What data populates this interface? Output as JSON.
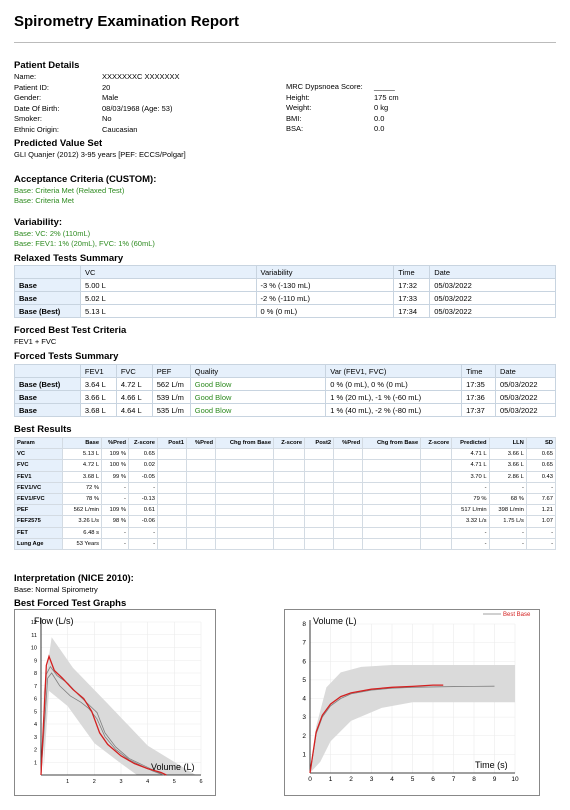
{
  "report": {
    "title": "Spirometry Examination Report"
  },
  "patient": {
    "heading": "Patient Details",
    "name_label": "Name:",
    "name_value": "XXXXXXXC XXXXXXX",
    "id_label": "Patient ID:",
    "id_value": "20",
    "gender_label": "Gender:",
    "gender_value": "Male",
    "dob_label": "Date Of Birth:",
    "dob_value": "08/03/1968   (Age: 53)",
    "smoker_label": "Smoker:",
    "smoker_value": "No",
    "ethnic_label": "Ethnic Origin:",
    "ethnic_value": "Caucasian",
    "mrc_label": "MRC Dypsnoea Score:",
    "mrc_value": "_____",
    "height_label": "Height:",
    "height_value": "175 cm",
    "weight_label": "Weight:",
    "weight_value": "0 kg",
    "bmi_label": "BMI:",
    "bmi_value": "0.0",
    "bsa_label": "BSA:",
    "bsa_value": "0.0"
  },
  "predicted": {
    "heading": "Predicted Value Set",
    "text": "GLI Quanjer (2012) 3-95 years [PEF: ECCS/Polgar]"
  },
  "acceptance": {
    "heading": "Acceptance Criteria (CUSTOM):",
    "line1": "Base: Criteria Met (Relaxed Test)",
    "line2": "Base: Criteria Met"
  },
  "variability": {
    "heading": "Variability:",
    "line1": "Base:  VC: 2% (110mL)",
    "line2": "Base:  FEV1: 1% (20mL), FVC: 1% (60mL)"
  },
  "relaxed": {
    "heading": "Relaxed Tests Summary",
    "headers": [
      "",
      "VC",
      "Variability",
      "Time",
      "Date"
    ],
    "rows": [
      [
        "Base",
        "5.00 L",
        "-3 % (-130 mL)",
        "17:32",
        "05/03/2022"
      ],
      [
        "Base",
        "5.02 L",
        "-2 % (-110 mL)",
        "17:33",
        "05/03/2022"
      ],
      [
        "Base (Best)",
        "5.13 L",
        "0 % (0 mL)",
        "17:34",
        "05/03/2022"
      ]
    ]
  },
  "forced_criteria": {
    "heading": "Forced Best Test Criteria",
    "text": "FEV1 + FVC"
  },
  "forced": {
    "heading": "Forced Tests Summary",
    "headers": [
      "",
      "FEV1",
      "FVC",
      "PEF",
      "Quality",
      "Var (FEV1, FVC)",
      "Time",
      "Date"
    ],
    "rows": [
      [
        "Base (Best)",
        "3.64 L",
        "4.72 L",
        "562 L/m",
        "Good Blow",
        "0 % (0 mL), 0 % (0 mL)",
        "17:35",
        "05/03/2022"
      ],
      [
        "Base",
        "3.66 L",
        "4.66 L",
        "539 L/m",
        "Good Blow",
        "1 % (20 mL), -1 % (-60 mL)",
        "17:36",
        "05/03/2022"
      ],
      [
        "Base",
        "3.68 L",
        "4.64 L",
        "535 L/m",
        "Good Blow",
        "1 % (40 mL), -2 % (-80 mL)",
        "17:37",
        "05/03/2022"
      ]
    ]
  },
  "best": {
    "heading": "Best Results",
    "headers": [
      "Param",
      "Base",
      "%Pred",
      "Z-score",
      "Post1",
      "%Pred",
      "Chg from Base",
      "Z-score",
      "Post2",
      "%Pred",
      "Chg from Base",
      "Z-score",
      "Predicted",
      "LLN",
      "SD"
    ],
    "rows": [
      [
        "VC",
        "5.13 L",
        "109 %",
        "0.65",
        "",
        "",
        "",
        "",
        "",
        "",
        "",
        "",
        "4.71 L",
        "3.66 L",
        "0.65"
      ],
      [
        "FVC",
        "4.72 L",
        "100 %",
        "0.02",
        "",
        "",
        "",
        "",
        "",
        "",
        "",
        "",
        "4.71 L",
        "3.66 L",
        "0.65"
      ],
      [
        "FEV1",
        "3.68 L",
        "99 %",
        "-0.05",
        "",
        "",
        "",
        "",
        "",
        "",
        "",
        "",
        "3.70 L",
        "2.86 L",
        "0.43"
      ],
      [
        "FEV1/VC",
        "72 %",
        "-",
        "-",
        "",
        "",
        "",
        "",
        "",
        "",
        "",
        "",
        "-",
        "-",
        "-"
      ],
      [
        "FEV1/FVC",
        "78 %",
        "-",
        "-0.13",
        "",
        "",
        "",
        "",
        "",
        "",
        "",
        "",
        "79 %",
        "68 %",
        "7.67"
      ],
      [
        "PEF",
        "562 L/min",
        "109 %",
        "0.61",
        "",
        "",
        "",
        "",
        "",
        "",
        "",
        "",
        "517 L/min",
        "398 L/min",
        "1.21"
      ],
      [
        "FEF2575",
        "3.26 L/s",
        "98 %",
        "-0.06",
        "",
        "",
        "",
        "",
        "",
        "",
        "",
        "",
        "3.32 L/s",
        "1.75 L/s",
        "1.07"
      ],
      [
        "FET",
        "6.48 s",
        "-",
        "-",
        "",
        "",
        "",
        "",
        "",
        "",
        "",
        "",
        "-",
        "-",
        "-"
      ],
      [
        "Lung Age",
        "53 Years",
        "-",
        "-",
        "",
        "",
        "",
        "",
        "",
        "",
        "",
        "",
        "-",
        "-",
        "-"
      ]
    ]
  },
  "interpretation": {
    "heading": "Interpretation (NICE 2010):",
    "text": "Base: Normal Spirometry"
  },
  "graphs": {
    "heading": "Best Forced Test Graphs",
    "flow_ylabel": "Flow (L/s)",
    "flow_xlabel": "Volume (L)",
    "vol_ylabel": "Volume (L)",
    "vol_xlabel": "Time (s)",
    "legend": "Best Base",
    "best_color": "#d42020",
    "trial_color": "#808080",
    "band_color": "#dadada"
  },
  "chart_data": [
    {
      "type": "line",
      "ylabel": "Flow (L/s)",
      "xlabel": "Volume (L)",
      "xlim": [
        0,
        6
      ],
      "ylim": [
        0,
        12
      ],
      "xticks": [
        1,
        2,
        3,
        4,
        5,
        6
      ],
      "yticks": [
        1,
        2,
        3,
        4,
        5,
        6,
        7,
        8,
        9,
        10,
        11,
        12
      ],
      "band_upper": [
        [
          0.1,
          6.5
        ],
        [
          0.4,
          10.8
        ],
        [
          1.2,
          8.4
        ],
        [
          2.5,
          5.6
        ],
        [
          4,
          2.3
        ],
        [
          5.8,
          0
        ]
      ],
      "band_lower": [
        [
          0.1,
          0.4
        ],
        [
          0.3,
          6.6
        ],
        [
          1,
          5.4
        ],
        [
          2,
          2.5
        ],
        [
          3,
          0.9
        ],
        [
          3.6,
          0
        ]
      ],
      "series": [
        {
          "name": "Best Base",
          "x": [
            0,
            0.2,
            0.3,
            0.5,
            0.8,
            1.2,
            1.6,
            1.9,
            2.2,
            2.5,
            3,
            3.5,
            4,
            4.5,
            4.7
          ],
          "y": [
            0,
            8.6,
            9.3,
            8.2,
            7.6,
            6.7,
            6,
            5,
            3.3,
            2.4,
            1.5,
            0.9,
            0.5,
            0.2,
            0
          ]
        },
        {
          "name": "",
          "x": [
            0,
            0.2,
            0.35,
            0.6,
            1,
            1.4,
            1.8,
            2.1,
            2.4,
            2.8,
            3.3,
            3.8,
            4.3,
            4.6
          ],
          "y": [
            0,
            7.9,
            8.5,
            7.8,
            7.2,
            6.3,
            5.5,
            4.9,
            3.3,
            2.2,
            1.3,
            0.8,
            0.3,
            0
          ]
        },
        {
          "name": "",
          "x": [
            0,
            0.25,
            0.4,
            0.7,
            1.1,
            1.5,
            1.8,
            2.1,
            2.4,
            2.8,
            3.3,
            3.8,
            4.2,
            4.6
          ],
          "y": [
            0,
            7.6,
            8,
            7,
            6.2,
            5.7,
            5.2,
            4.4,
            3,
            2,
            1.2,
            0.7,
            0.3,
            0
          ]
        }
      ]
    },
    {
      "type": "line",
      "ylabel": "Volume (L)",
      "xlabel": "Time (s)",
      "xlim": [
        0,
        10
      ],
      "ylim": [
        0,
        8
      ],
      "xticks": [
        1,
        2,
        3,
        4,
        5,
        6,
        7,
        8,
        9,
        10
      ],
      "yticks": [
        1,
        2,
        3,
        4,
        5,
        6,
        7,
        8
      ],
      "band_upper": [
        [
          0,
          0
        ],
        [
          0.3,
          2.5
        ],
        [
          0.8,
          4.6
        ],
        [
          1.5,
          5.4
        ],
        [
          2.5,
          5.7
        ],
        [
          4,
          5.8
        ],
        [
          10,
          5.8
        ]
      ],
      "band_lower": [
        [
          0,
          0
        ],
        [
          0.5,
          0.6
        ],
        [
          1,
          1.7
        ],
        [
          2,
          2.8
        ],
        [
          3.5,
          3.5
        ],
        [
          5,
          3.8
        ],
        [
          10,
          3.8
        ]
      ],
      "series": [
        {
          "name": "Best Base",
          "x": [
            0,
            0.3,
            0.6,
            1,
            1.5,
            2,
            3,
            4,
            5,
            6,
            6.5
          ],
          "y": [
            0,
            2.2,
            3.1,
            3.7,
            4.1,
            4.3,
            4.5,
            4.6,
            4.65,
            4.72,
            4.72
          ]
        },
        {
          "name": "",
          "x": [
            0,
            0.3,
            0.6,
            1,
            1.5,
            2,
            3,
            4,
            5,
            6,
            7,
            8,
            9
          ],
          "y": [
            0,
            2.1,
            3,
            3.6,
            4,
            4.25,
            4.45,
            4.55,
            4.6,
            4.62,
            4.64,
            4.65,
            4.66
          ]
        }
      ]
    }
  ]
}
